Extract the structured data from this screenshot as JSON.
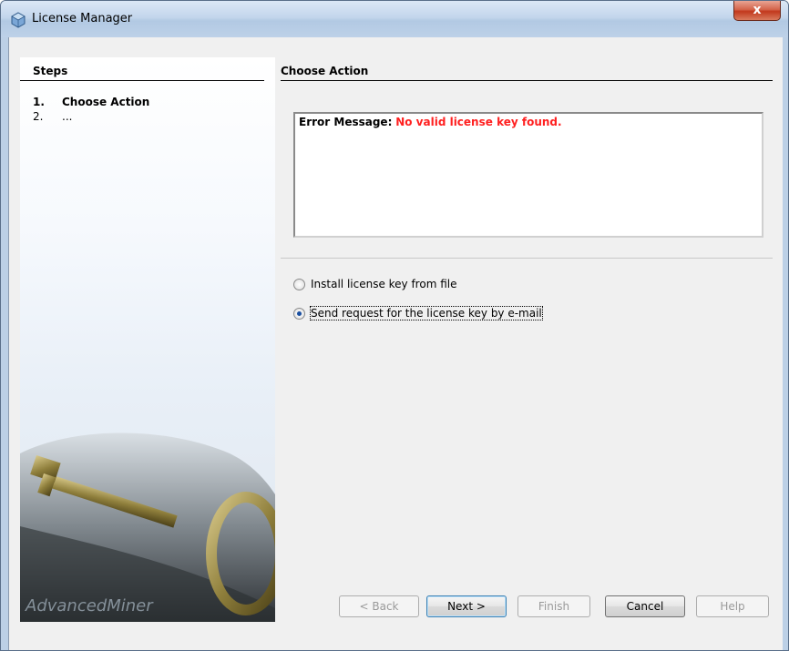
{
  "window": {
    "title": "License Manager",
    "close_label": "x"
  },
  "steps": {
    "header": "Steps",
    "items": [
      {
        "num": "1.",
        "label": "Choose Action"
      },
      {
        "num": "2.",
        "label": "..."
      }
    ],
    "brand": "AdvancedMiner"
  },
  "main": {
    "header": "Choose Action",
    "message_label": "Error Message:",
    "message_value": "No valid license key found.",
    "options": [
      {
        "label": "Install license key from file",
        "checked": false
      },
      {
        "label": "Send request for the license key by e-mail",
        "checked": true
      }
    ]
  },
  "buttons": {
    "back": "< Back",
    "next": "Next >",
    "finish": "Finish",
    "cancel": "Cancel",
    "help": "Help"
  },
  "colors": {
    "error_text": "#ff2020",
    "title_bar": "#bcd0e6",
    "close_button": "#c2391d"
  }
}
